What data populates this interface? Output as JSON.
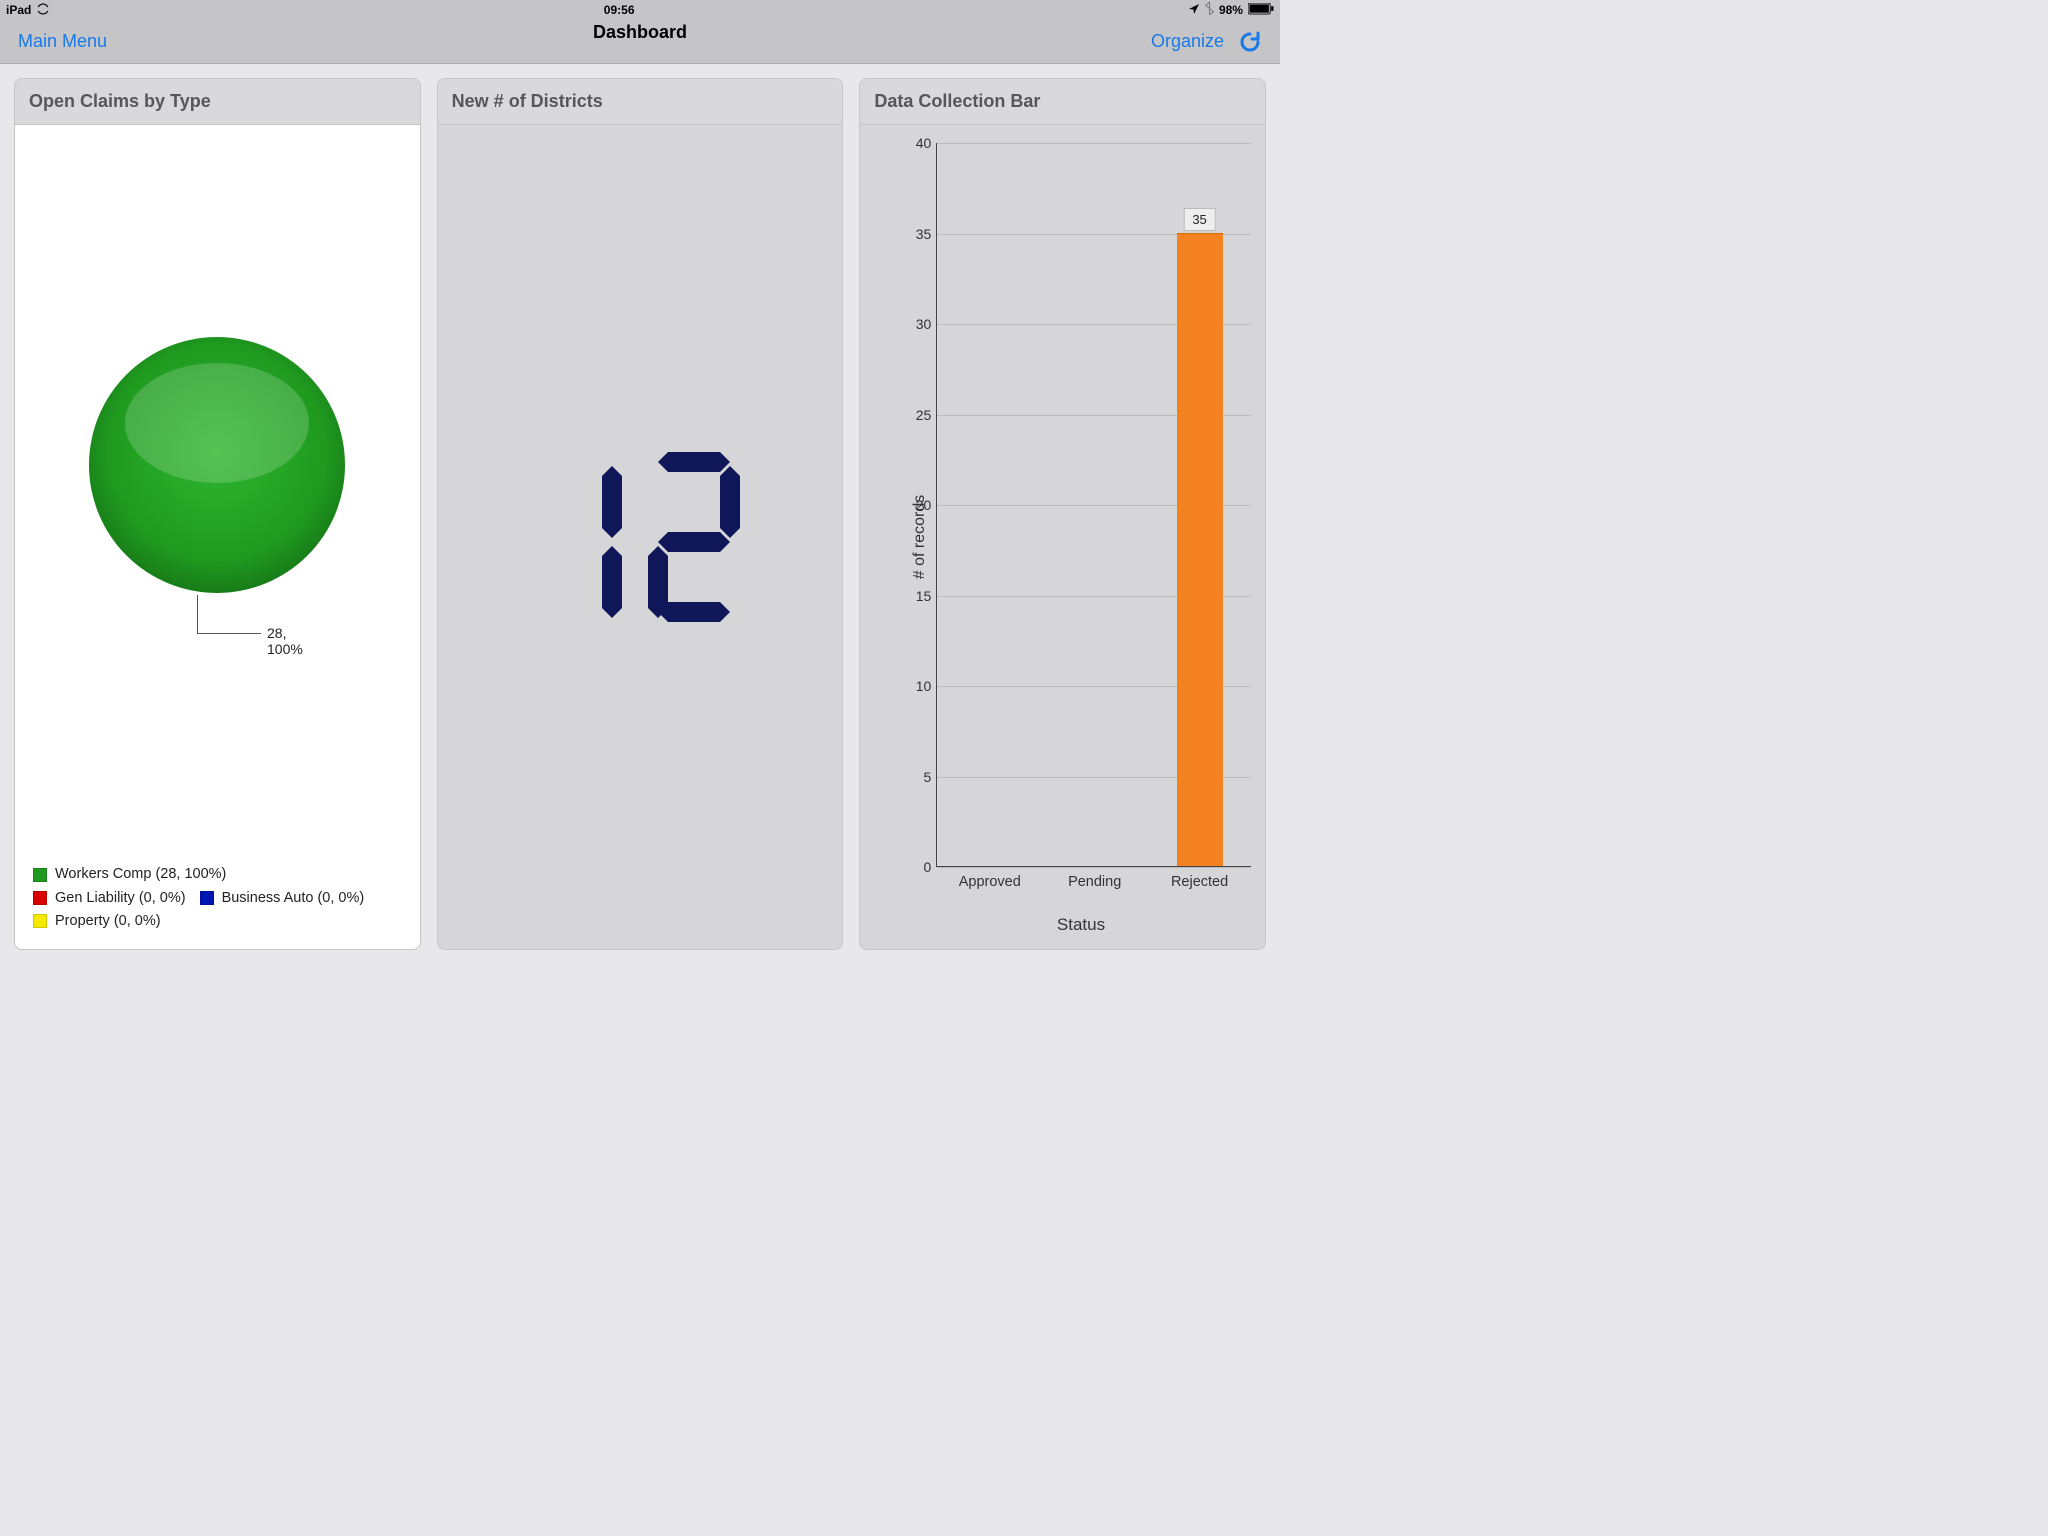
{
  "statusbar": {
    "device": "iPad",
    "time": "09:56",
    "battery": "98%"
  },
  "navbar": {
    "left": "Main Menu",
    "title": "Dashboard",
    "organize": "Organize"
  },
  "panels": {
    "claims": {
      "title": "Open Claims by Type",
      "callout": "28, 100%",
      "legend": [
        {
          "label": "Workers Comp (28, 100%)",
          "color": "#1f9a1f"
        },
        {
          "label": "Gen Liability (0, 0%)",
          "color": "#d60000"
        },
        {
          "label": "Business Auto (0, 0%)",
          "color": "#0016b3"
        },
        {
          "label": "Property (0, 0%)",
          "color": "#f5e900"
        }
      ]
    },
    "districts": {
      "title": "New # of Districts",
      "value": "12"
    },
    "bar": {
      "title": "Data Collection Bar",
      "ylabel": "# of records",
      "xlabel": "Status"
    }
  },
  "chart_data": [
    {
      "type": "pie",
      "title": "Open Claims by Type",
      "series": [
        {
          "name": "Workers Comp",
          "value": 28,
          "pct": 100,
          "color": "#1f9a1f"
        },
        {
          "name": "Gen Liability",
          "value": 0,
          "pct": 0,
          "color": "#d60000"
        },
        {
          "name": "Business Auto",
          "value": 0,
          "pct": 0,
          "color": "#0016b3"
        },
        {
          "name": "Property",
          "value": 0,
          "pct": 0,
          "color": "#f5e900"
        }
      ]
    },
    {
      "type": "bar",
      "title": "Data Collection Bar",
      "xlabel": "Status",
      "ylabel": "# of records",
      "ylim": [
        0,
        40
      ],
      "yticks": [
        0,
        5,
        10,
        15,
        20,
        25,
        30,
        35,
        40
      ],
      "categories": [
        "Approved",
        "Pending",
        "Rejected"
      ],
      "values": [
        0,
        0,
        35
      ],
      "bar_color": "#f58220"
    }
  ]
}
